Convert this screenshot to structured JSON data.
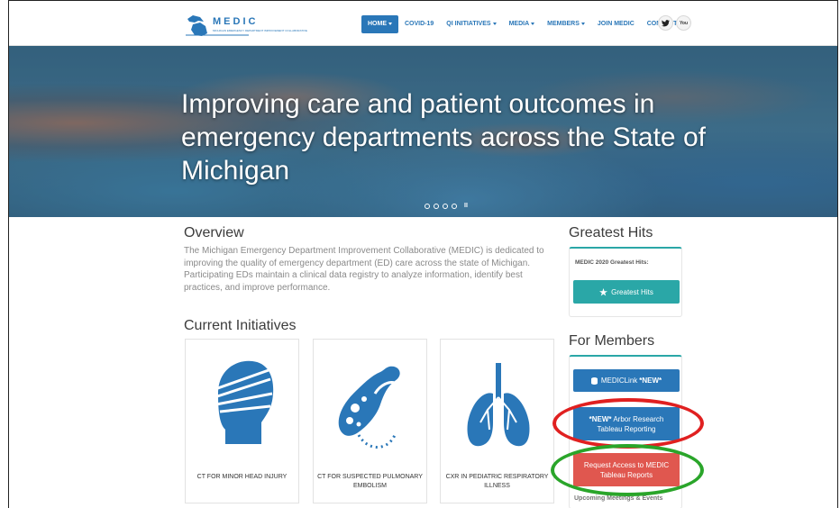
{
  "header": {
    "logo_text": "MEDIC",
    "logo_subtext": "MICHIGAN EMERGENCY DEPARTMENT IMPROVEMENT COLLABORATIVE",
    "nav": [
      {
        "label": "HOME",
        "dropdown": true,
        "active": true
      },
      {
        "label": "COVID-19",
        "dropdown": false,
        "active": false
      },
      {
        "label": "QI INITIATIVES",
        "dropdown": true,
        "active": false
      },
      {
        "label": "MEDIA",
        "dropdown": true,
        "active": false
      },
      {
        "label": "MEMBERS",
        "dropdown": true,
        "active": false
      },
      {
        "label": "JOIN MEDIC",
        "dropdown": false,
        "active": false
      },
      {
        "label": "CONTACT US",
        "dropdown": false,
        "active": false
      }
    ],
    "social_icons": [
      "twitter-icon",
      "youtube-icon"
    ],
    "twitter_glyph": "🐦",
    "youtube_glyph": "You"
  },
  "hero": {
    "title": "Improving care and patient outcomes in emergency departments across the State of Michigan",
    "slide_count": 4,
    "pause_glyph": "II"
  },
  "overview": {
    "title": "Overview",
    "text": "The Michigan Emergency Department Improvement Collaborative (MEDIC) is dedicated to improving the quality of emergency department (ED) care across the state of Michigan. Participating EDs maintain a clinical data registry to analyze information, identify best practices, and improve performance."
  },
  "initiatives": {
    "title": "Current Initiatives",
    "cards": [
      {
        "label": "CT FOR MINOR HEAD INJURY",
        "icon": "head-injury-icon"
      },
      {
        "label": "CT FOR SUSPECTED PULMONARY EMBOLISM",
        "icon": "pulmonary-embolism-icon"
      },
      {
        "label": "CXR IN PEDIATRIC RESPIRATORY ILLNESS",
        "icon": "lungs-icon"
      }
    ]
  },
  "greatest_hits": {
    "title": "Greatest Hits",
    "subtitle": "MEDIC 2020 Greatest Hits:",
    "button_label": "Greatest Hits"
  },
  "members": {
    "title": "For Members",
    "medic_link_label": "MEDICLink ",
    "medic_link_new": "*NEW*",
    "arbor_new": "*NEW*",
    "arbor_label": " Arbor Research Tableau Reporting",
    "request_label": "Request Access to MEDIC Tableau Reports",
    "meetings_label": "Upcoming Meetings & Events"
  },
  "colors": {
    "brand_blue": "#2a77b8",
    "teal": "#2aa7a7",
    "request_red": "#e0574f",
    "annotation_red": "#e02020",
    "annotation_green": "#2aa52a"
  }
}
